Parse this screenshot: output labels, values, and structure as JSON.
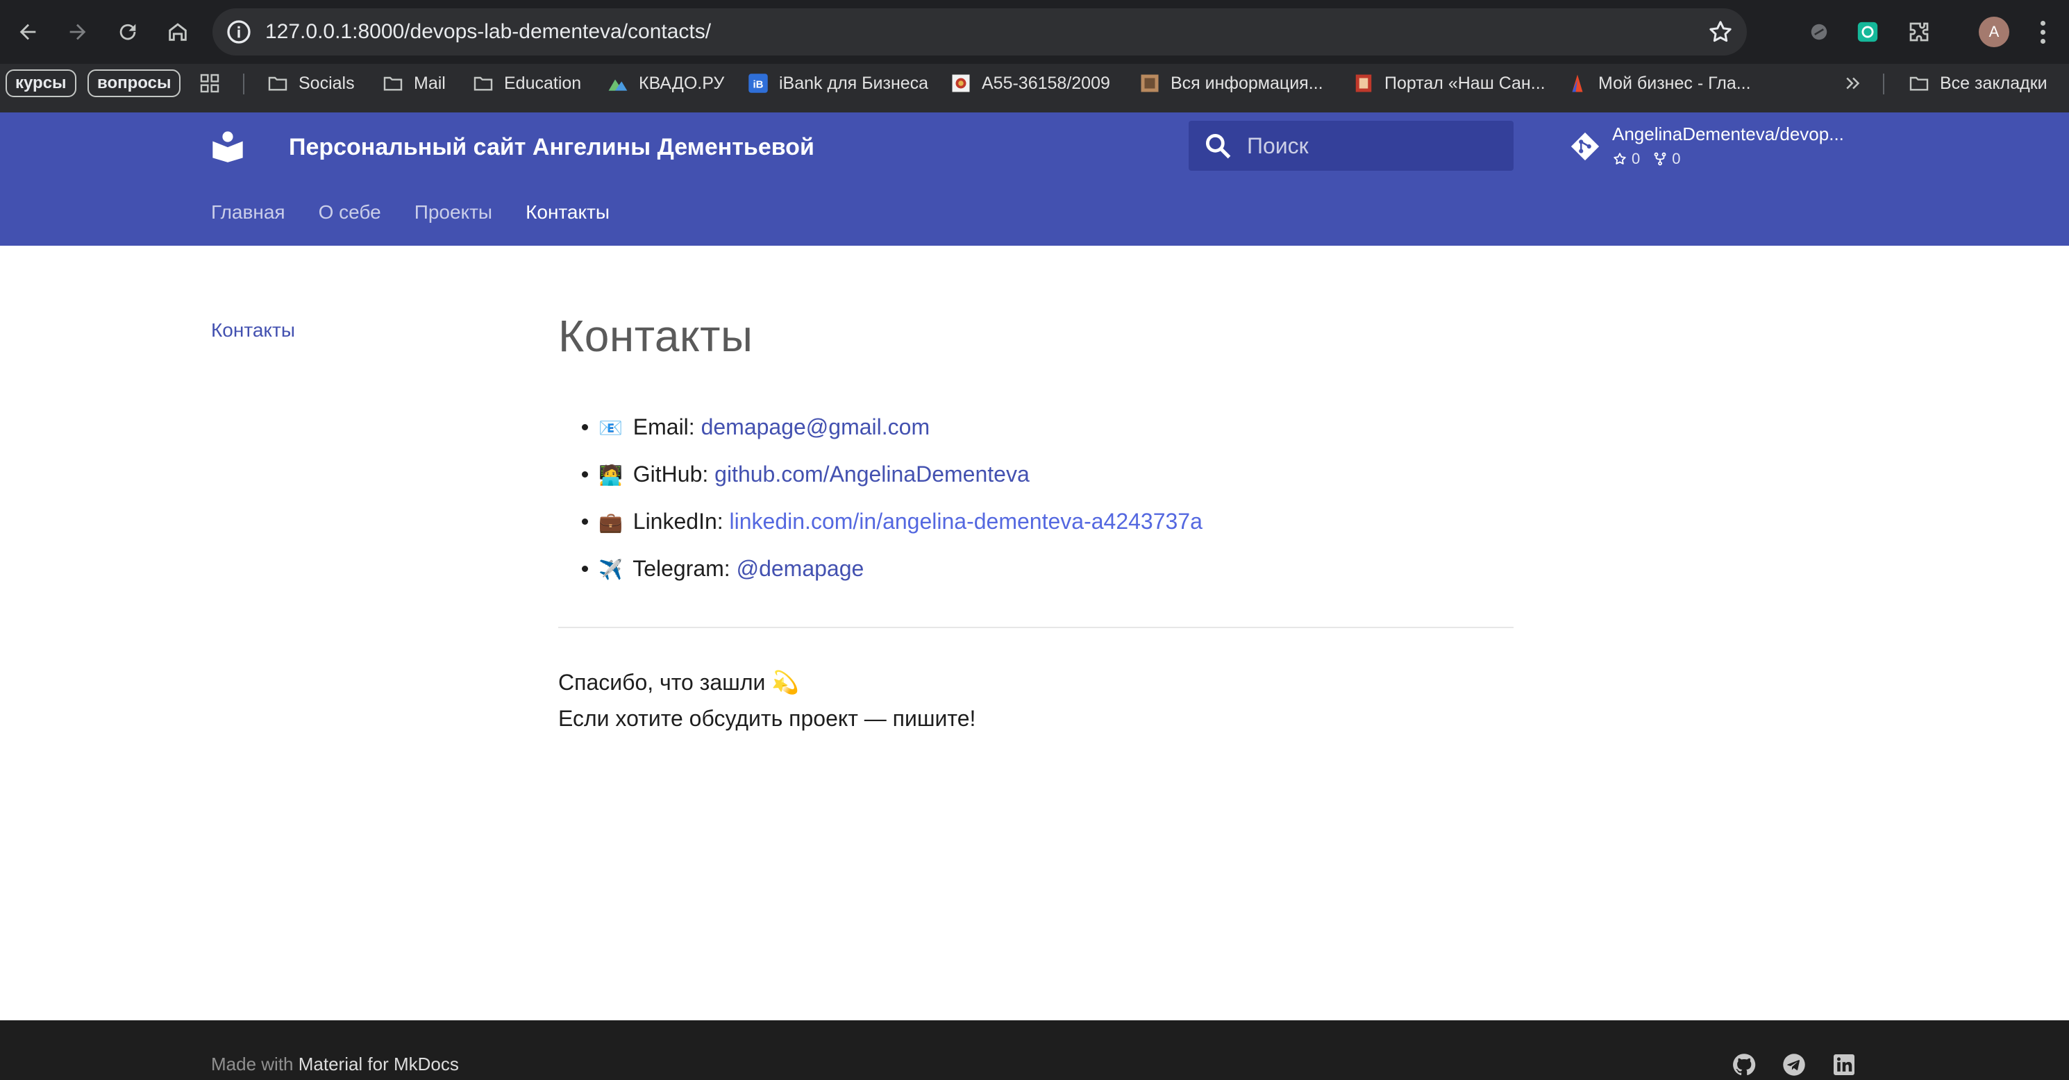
{
  "browser": {
    "url": "127.0.0.1:8000/devops-lab-dementeva/contacts/",
    "avatar_letter": "A",
    "bookmarks_pills": [
      "курсы",
      "вопросы"
    ],
    "bookmarks": [
      {
        "label": "Socials",
        "icon": "folder-icon"
      },
      {
        "label": "Mail",
        "icon": "folder-icon"
      },
      {
        "label": "Education",
        "icon": "folder-icon"
      },
      {
        "label": "КВАДО.РУ",
        "icon": "kvado-icon"
      },
      {
        "label": "iBank для Бизнеса",
        "icon": "ibank-icon"
      },
      {
        "label": "А55-36158/2009",
        "icon": "emblem-icon"
      },
      {
        "label": "Вся информация...",
        "icon": "photo-icon"
      },
      {
        "label": "Портал «Наш Сан...",
        "icon": "portal-icon"
      },
      {
        "label": "Мой бизнес - Гла...",
        "icon": "business-icon"
      }
    ],
    "all_bookmarks": "Все закладки"
  },
  "header": {
    "title": "Персональный сайт Ангелины Дементьевой",
    "search_placeholder": "Поиск",
    "repo_name": "AngelinaDementeva/devop...",
    "stars": "0",
    "forks": "0",
    "tabs": [
      "Главная",
      "О себе",
      "Проекты",
      "Контакты"
    ],
    "active_tab": "Контакты"
  },
  "sidebar": {
    "toc_item": "Контакты"
  },
  "main": {
    "title": "Контакты",
    "contacts": [
      {
        "emoji": "📧",
        "label": "Email:",
        "value": "demapage@gmail.com"
      },
      {
        "emoji": "🧑‍💻",
        "label": "GitHub:",
        "value": "github.com/AngelinaDementeva"
      },
      {
        "emoji": "💼",
        "label": "LinkedIn:",
        "value": "linkedin.com/in/angelina-dementeva-a4243737a"
      },
      {
        "emoji": "✈️",
        "label": "Telegram:",
        "value": "@demapage"
      }
    ],
    "thanks_line1": "Спасибо, что зашли",
    "thanks_emoji": "💫",
    "thanks_line2": "Если хотите обсудить проект — пишите!"
  },
  "footer": {
    "made_with": "Made with",
    "made_with_link": "Material for MkDocs"
  },
  "colors": {
    "primary": "#4351b0",
    "link": "#4351b0",
    "footer_bg": "#1e1e1e"
  }
}
